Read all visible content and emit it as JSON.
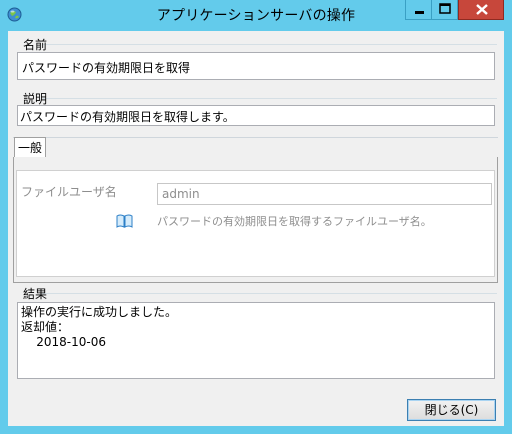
{
  "window": {
    "title": "アプリケーションサーバの操作",
    "controls": {
      "minimize_icon": "minimize-icon",
      "maximize_icon": "maximize-icon",
      "close_icon": "close-icon"
    }
  },
  "name_group": {
    "label": "名前",
    "value": "パスワードの有効期限日を取得"
  },
  "description_group": {
    "label": "説明",
    "value": "パスワードの有効期限日を取得します。"
  },
  "tabs": [
    {
      "label": "一般"
    }
  ],
  "general": {
    "file_user_label": "ファイルユーザ名",
    "file_user_value": "admin",
    "help_icon": "book-icon",
    "help_text": "パスワードの有効期限日を取得するファイルユーザ名。"
  },
  "result_group": {
    "label": "結果",
    "lines": [
      "操作の実行に成功しました。",
      "返却値：",
      "    2018-10-06"
    ]
  },
  "buttons": {
    "close": "閉じる(C)"
  },
  "colors": {
    "titlebar": "#63cbeb",
    "close_button": "#c7473b",
    "client_bg": "#f0f0f0"
  }
}
